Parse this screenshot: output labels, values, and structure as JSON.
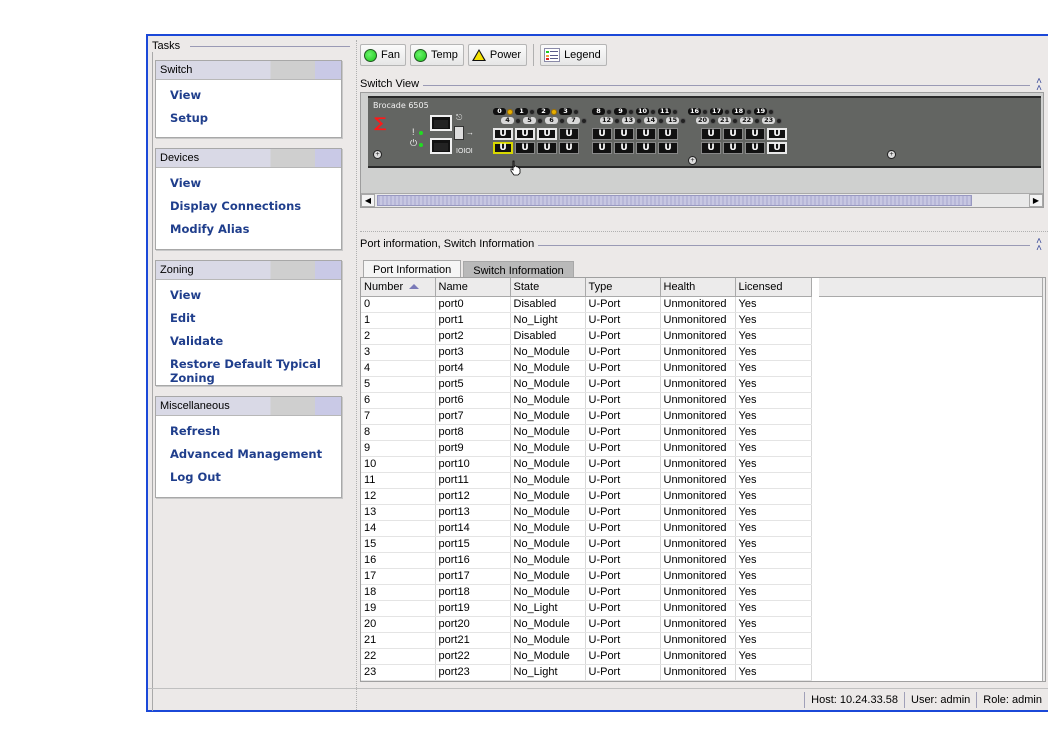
{
  "tasks": {
    "title": "Tasks",
    "groups": [
      {
        "title": "Switch",
        "items": [
          "View",
          "Setup"
        ]
      },
      {
        "title": "Devices",
        "items": [
          "View",
          "Display Connections",
          "Modify Alias"
        ]
      },
      {
        "title": "Zoning",
        "items": [
          "View",
          "Edit",
          "Validate",
          "Restore Default Typical Zoning"
        ]
      },
      {
        "title": "Miscellaneous",
        "items": [
          "Refresh",
          "Advanced Management",
          "Log Out"
        ]
      }
    ]
  },
  "toolbar": {
    "fan": {
      "label": "Fan",
      "icon": "green-circle-icon",
      "status_color": "#22cc22"
    },
    "temp": {
      "label": "Temp",
      "icon": "green-circle-icon",
      "status_color": "#22cc22"
    },
    "power": {
      "label": "Power",
      "icon": "warning-triangle-icon",
      "status_color": "#f5e200"
    },
    "legend": {
      "label": "Legend",
      "icon": "legend-icon"
    }
  },
  "switch_view": {
    "title": "Switch View",
    "model": "Brocade 6505",
    "port_groups": [
      {
        "top": [
          "0",
          "1",
          "2",
          "3"
        ],
        "bottom": [
          "4",
          "5",
          "6",
          "7"
        ],
        "amber": [
          "0",
          "2"
        ]
      },
      {
        "top": [
          "8",
          "9",
          "10",
          "11"
        ],
        "bottom": [
          "12",
          "13",
          "14",
          "15"
        ],
        "amber": []
      },
      {
        "top": [
          "16",
          "17",
          "18",
          "19"
        ],
        "bottom": [
          "20",
          "21",
          "22",
          "23"
        ],
        "amber": []
      }
    ],
    "port_glyph": "U",
    "selected_port": "4"
  },
  "port_info": {
    "title": "Port information, Switch Information",
    "tabs": [
      "Port Information",
      "Switch Information"
    ],
    "active_tab": 0,
    "columns": [
      "Number",
      "Name",
      "State",
      "Type",
      "Health",
      "Licensed"
    ],
    "sort_column": "Number",
    "rows": [
      [
        "0",
        "port0",
        "Disabled",
        "U-Port",
        "Unmonitored",
        "Yes"
      ],
      [
        "1",
        "port1",
        "No_Light",
        "U-Port",
        "Unmonitored",
        "Yes"
      ],
      [
        "2",
        "port2",
        "Disabled",
        "U-Port",
        "Unmonitored",
        "Yes"
      ],
      [
        "3",
        "port3",
        "No_Module",
        "U-Port",
        "Unmonitored",
        "Yes"
      ],
      [
        "4",
        "port4",
        "No_Module",
        "U-Port",
        "Unmonitored",
        "Yes"
      ],
      [
        "5",
        "port5",
        "No_Module",
        "U-Port",
        "Unmonitored",
        "Yes"
      ],
      [
        "6",
        "port6",
        "No_Module",
        "U-Port",
        "Unmonitored",
        "Yes"
      ],
      [
        "7",
        "port7",
        "No_Module",
        "U-Port",
        "Unmonitored",
        "Yes"
      ],
      [
        "8",
        "port8",
        "No_Module",
        "U-Port",
        "Unmonitored",
        "Yes"
      ],
      [
        "9",
        "port9",
        "No_Module",
        "U-Port",
        "Unmonitored",
        "Yes"
      ],
      [
        "10",
        "port10",
        "No_Module",
        "U-Port",
        "Unmonitored",
        "Yes"
      ],
      [
        "11",
        "port11",
        "No_Module",
        "U-Port",
        "Unmonitored",
        "Yes"
      ],
      [
        "12",
        "port12",
        "No_Module",
        "U-Port",
        "Unmonitored",
        "Yes"
      ],
      [
        "13",
        "port13",
        "No_Module",
        "U-Port",
        "Unmonitored",
        "Yes"
      ],
      [
        "14",
        "port14",
        "No_Module",
        "U-Port",
        "Unmonitored",
        "Yes"
      ],
      [
        "15",
        "port15",
        "No_Module",
        "U-Port",
        "Unmonitored",
        "Yes"
      ],
      [
        "16",
        "port16",
        "No_Module",
        "U-Port",
        "Unmonitored",
        "Yes"
      ],
      [
        "17",
        "port17",
        "No_Module",
        "U-Port",
        "Unmonitored",
        "Yes"
      ],
      [
        "18",
        "port18",
        "No_Module",
        "U-Port",
        "Unmonitored",
        "Yes"
      ],
      [
        "19",
        "port19",
        "No_Light",
        "U-Port",
        "Unmonitored",
        "Yes"
      ],
      [
        "20",
        "port20",
        "No_Module",
        "U-Port",
        "Unmonitored",
        "Yes"
      ],
      [
        "21",
        "port21",
        "No_Module",
        "U-Port",
        "Unmonitored",
        "Yes"
      ],
      [
        "22",
        "port22",
        "No_Module",
        "U-Port",
        "Unmonitored",
        "Yes"
      ],
      [
        "23",
        "port23",
        "No_Light",
        "U-Port",
        "Unmonitored",
        "Yes"
      ]
    ]
  },
  "status_bar": {
    "host": "Host: 10.24.33.58",
    "user": "User: admin",
    "role": "Role: admin"
  }
}
